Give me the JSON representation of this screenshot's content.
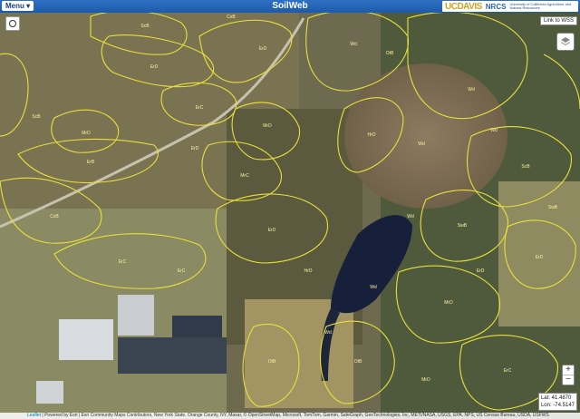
{
  "header": {
    "menu_label": "Menu ▾",
    "title": "SoilWeb",
    "logo_ucdavis": "UCDAVIS",
    "logo_nrcs": "NRCS",
    "logo_uc_info": "University of California Agriculture and Natural Resources"
  },
  "controls": {
    "wss_link": "Link to WSS",
    "zoom_in": "+",
    "zoom_out": "−"
  },
  "coordinates": {
    "lat_label": "Lat: 41.4870",
    "lon_label": "Lon: -74.5147"
  },
  "attribution": {
    "leaflet": "Leaflet",
    "text": "| Powered by Esri | Esri Community Maps Contributors, New York State, Orange County, NY, Maxar, © OpenStreetMap, Microsoft, TomTom, Garmin, SafeGraph, GeoTechnologies, Inc, METI/NASA, USGS, EPA, NPS, US Census Bureau, USDA, USFWS"
  },
  "map": {
    "basemap": "satellite",
    "overlay_color": "#e8e03a",
    "soil_unit_labels": [
      "ScB",
      "ErD",
      "MrD",
      "ErB",
      "Wd",
      "Wd",
      "Wd",
      "Wd",
      "Wd",
      "Wd",
      "Wd",
      "ErC",
      "ErD",
      "MrD",
      "MrC",
      "CsB",
      "ErC",
      "ErD",
      "HrD",
      "ScB",
      "SwB",
      "ErD",
      "MrD",
      "OtB",
      "OtB",
      "ErC",
      "ErD",
      "ScB",
      "CsB",
      "OtB",
      "SwB",
      "ErD",
      "MrD",
      "HrD",
      "ErC"
    ]
  }
}
